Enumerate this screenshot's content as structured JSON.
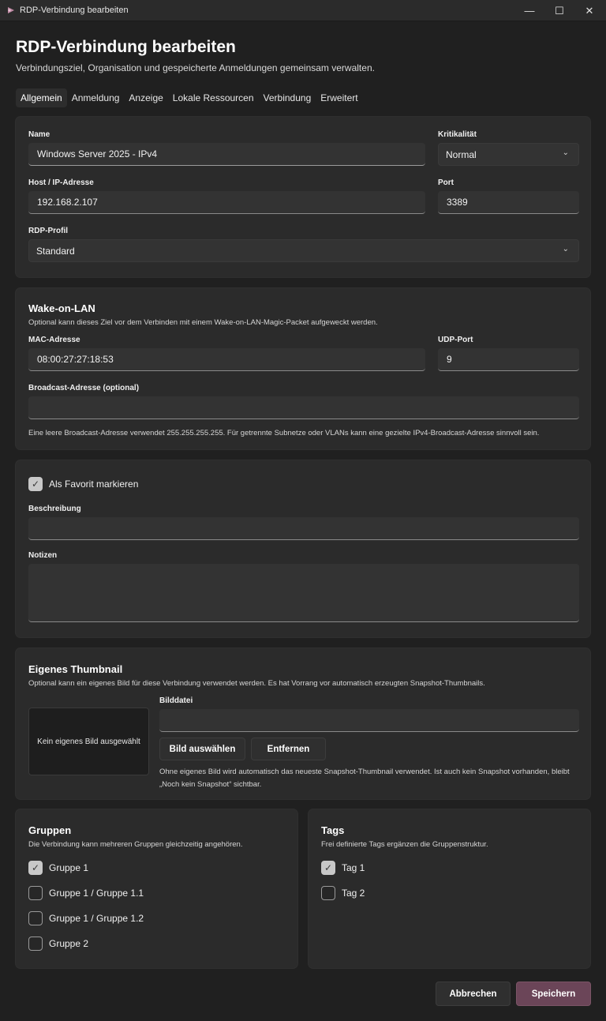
{
  "window": {
    "title": "RDP-Verbindung bearbeiten",
    "controls": {
      "minimize": "—",
      "maximize": "☐",
      "close": "✕"
    }
  },
  "header": {
    "title": "RDP-Verbindung bearbeiten",
    "subtitle": "Verbindungsziel, Organisation und gespeicherte Anmeldungen gemeinsam verwalten."
  },
  "tabs": [
    {
      "label": "Allgemein",
      "active": true
    },
    {
      "label": "Anmeldung"
    },
    {
      "label": "Anzeige"
    },
    {
      "label": "Lokale Ressourcen"
    },
    {
      "label": "Verbindung"
    },
    {
      "label": "Erweitert"
    }
  ],
  "general": {
    "name_label": "Name",
    "name_value": "Windows Server 2025 - IPv4",
    "criticality_label": "Kritikalität",
    "criticality_value": "Normal",
    "host_label": "Host / IP-Adresse",
    "host_value": "192.168.2.107",
    "port_label": "Port",
    "port_value": "3389",
    "profile_label": "RDP-Profil",
    "profile_value": "Standard"
  },
  "wol": {
    "title": "Wake-on-LAN",
    "description": "Optional kann dieses Ziel vor dem Verbinden mit einem Wake-on-LAN-Magic-Packet aufgeweckt werden.",
    "mac_label": "MAC-Adresse",
    "mac_value": "08:00:27:27:18:53",
    "udp_label": "UDP-Port",
    "udp_value": "9",
    "broadcast_label": "Broadcast-Adresse (optional)",
    "broadcast_value": "",
    "note": "Eine leere Broadcast-Adresse verwendet 255.255.255.255. Für getrennte Subnetze oder VLANs kann eine gezielte IPv4-Broadcast-Adresse sinnvoll sein."
  },
  "favorite": {
    "label": "Als Favorit markieren",
    "checked": true,
    "description_label": "Beschreibung",
    "description_value": "",
    "notes_label": "Notizen",
    "notes_value": ""
  },
  "thumbnail": {
    "title": "Eigenes Thumbnail",
    "description": "Optional kann ein eigenes Bild für diese Verbindung verwendet werden. Es hat Vorrang vor automatisch erzeugten Snapshot-Thumbnails.",
    "placeholder": "Kein eigenes Bild ausgewählt",
    "file_label": "Bilddatei",
    "file_value": "",
    "choose_button": "Bild auswählen",
    "remove_button": "Entfernen",
    "note": "Ohne eigenes Bild wird automatisch das neueste Snapshot-Thumbnail verwendet. Ist auch kein Snapshot vorhanden, bleibt „Noch kein Snapshot“ sichtbar."
  },
  "groups": {
    "title": "Gruppen",
    "description": "Die Verbindung kann mehreren Gruppen gleichzeitig angehören.",
    "items": [
      {
        "label": "Gruppe 1",
        "checked": true
      },
      {
        "label": "Gruppe 1 / Gruppe 1.1",
        "checked": false
      },
      {
        "label": "Gruppe 1 / Gruppe 1.2",
        "checked": false
      },
      {
        "label": "Gruppe 2",
        "checked": false
      }
    ]
  },
  "tags": {
    "title": "Tags",
    "description": "Frei definierte Tags ergänzen die Gruppenstruktur.",
    "items": [
      {
        "label": "Tag 1",
        "checked": true
      },
      {
        "label": "Tag 2",
        "checked": false
      }
    ]
  },
  "footer": {
    "cancel": "Abbrechen",
    "save": "Speichern"
  },
  "icons": {
    "checkmark": "✓",
    "chevron": "⌄"
  }
}
